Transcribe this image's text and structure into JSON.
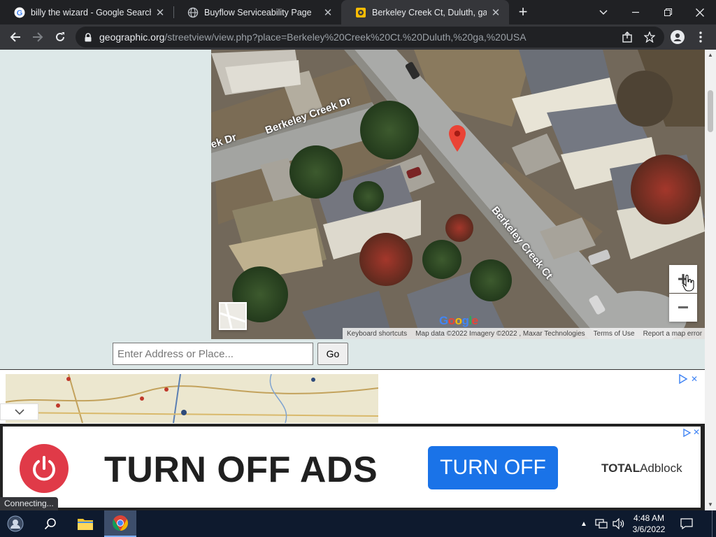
{
  "browser": {
    "tabs": [
      {
        "title": "billy the wizard - Google Search",
        "favicon": "google-g-icon",
        "active": false
      },
      {
        "title": "Buyflow Serviceability Page",
        "favicon": "globe-icon",
        "active": false
      },
      {
        "title": "Berkeley Creek Ct, Duluth, ga, USA",
        "favicon": "geographic-icon",
        "active": true
      }
    ],
    "url_host": "geographic.org",
    "url_path": "/streetview/view.php?place=Berkeley%20Creek%20Ct.%20Duluth,%20ga,%20USA",
    "status_text": "Connecting..."
  },
  "map": {
    "road_labels": [
      "Berkeley Creek Dr",
      "ek Dr",
      "Berkeley Creek Ct"
    ],
    "zoom_in": "+",
    "zoom_out": "−",
    "google_logo": "Google",
    "attribution": {
      "shortcuts": "Keyboard shortcuts",
      "data": "Map data ©2022 Imagery ©2022 , Maxar Technologies",
      "terms": "Terms of Use",
      "report": "Report a map error"
    },
    "marker_color": "#ea4335"
  },
  "search": {
    "placeholder": "Enter Address or Place...",
    "go_label": "Go"
  },
  "ad": {
    "headline": "TURN OFF ADS",
    "cta": "TURN OFF",
    "brand_bold": "TOTAL",
    "brand_rest": "Adblock",
    "ad_close": "✕",
    "ad_small_close": "×"
  },
  "taskbar": {
    "time": "4:48 AM",
    "date": "3/6/2022"
  }
}
